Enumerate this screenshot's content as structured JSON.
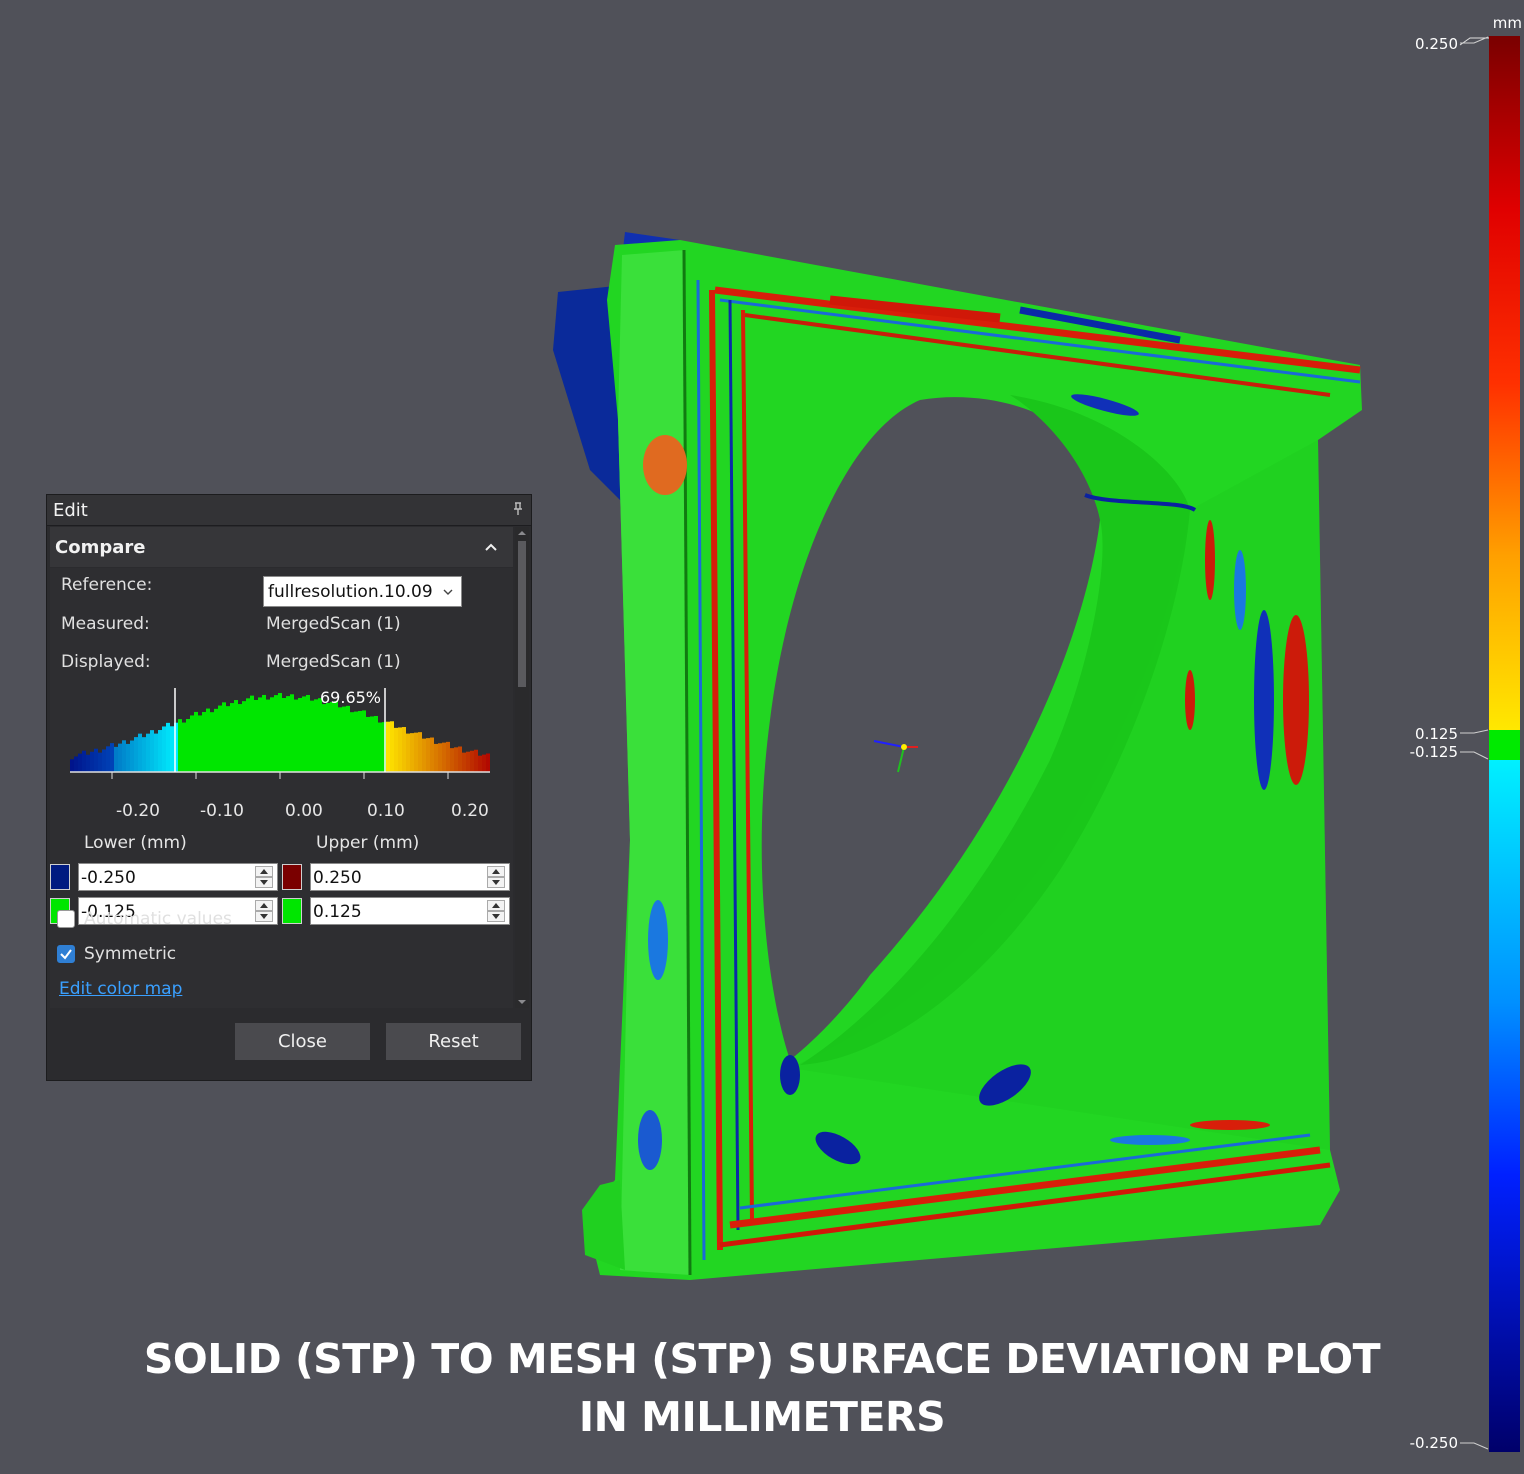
{
  "viewport": {
    "caption_line1": "SOLID (STP) TO MESH (STP) SURFACE DEVIATION PLOT",
    "caption_line2": "IN MILLIMETERS"
  },
  "color_scale": {
    "unit": "mm",
    "max_label": "0.250",
    "upper_tol_label": "0.125",
    "lower_tol_label": "-0.125",
    "min_label": "-0.250",
    "colors": {
      "max": "#8b0000",
      "upper": "#ffe000",
      "tolerance": "#00e600",
      "lower": "#00e8ff",
      "min": "#00007a"
    }
  },
  "edit_panel": {
    "title": "Edit",
    "pin_icon": "pin-icon",
    "section_title": "Compare",
    "collapse_icon": "chevron-up-icon",
    "reference_label": "Reference:",
    "reference_value": "fullresolution.10.09",
    "measured_label": "Measured:",
    "measured_value": "MergedScan (1)",
    "displayed_label": "Displayed:",
    "displayed_value": "MergedScan (1)",
    "histogram": {
      "in_tolerance_percent": "69.65%",
      "tick_labels": [
        "-0.20",
        "-0.10",
        "0.00",
        "0.10",
        "0.20"
      ]
    },
    "lower_header": "Lower (mm)",
    "upper_header": "Upper (mm)",
    "lower_outer_value": "-0.250",
    "lower_inner_value": "-0.125",
    "upper_outer_value": "0.250",
    "upper_inner_value": "0.125",
    "lower_outer_color": "#001a80",
    "lower_inner_color": "#00e600",
    "upper_outer_color": "#7a0000",
    "upper_inner_color": "#00e600",
    "automatic_values_label": "Automatic values",
    "automatic_values_checked": false,
    "symmetric_label": "Symmetric",
    "symmetric_checked": true,
    "edit_color_map_link": "Edit color map",
    "close_button": "Close",
    "reset_button": "Reset"
  }
}
